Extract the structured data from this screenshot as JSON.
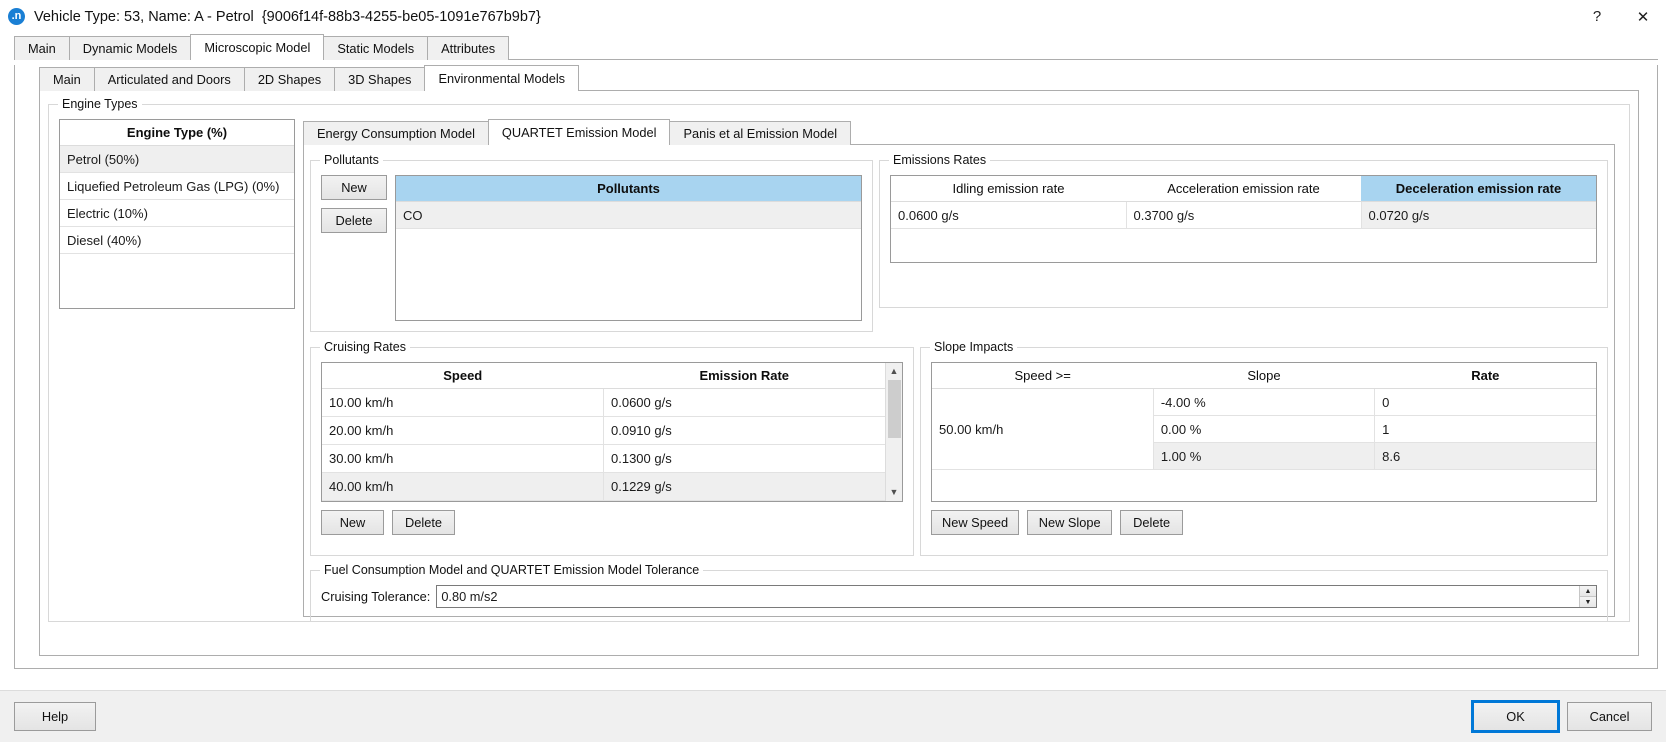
{
  "window": {
    "icon": "aimsun-app-icon",
    "title": "Vehicle Type: 53, Name: A - Petrol",
    "guid": "{9006f14f-88b3-4255-be05-1091e767b9b7}",
    "help_glyph": "?",
    "close_glyph": "✕"
  },
  "tabs_level1": [
    {
      "label": "Main",
      "active": false
    },
    {
      "label": "Dynamic Models",
      "active": false
    },
    {
      "label": "Microscopic Model",
      "active": true
    },
    {
      "label": "Static Models",
      "active": false
    },
    {
      "label": "Attributes",
      "active": false
    }
  ],
  "tabs_level2": [
    {
      "label": "Main",
      "active": false
    },
    {
      "label": "Articulated and Doors",
      "active": false
    },
    {
      "label": "2D Shapes",
      "active": false
    },
    {
      "label": "3D Shapes",
      "active": false
    },
    {
      "label": "Environmental Models",
      "active": true
    }
  ],
  "tabs_level3": [
    {
      "label": "Energy Consumption Model",
      "active": false
    },
    {
      "label": "QUARTET Emission Model",
      "active": true
    },
    {
      "label": "Panis et al Emission Model",
      "active": false
    }
  ],
  "engine_types": {
    "legend": "Engine Types",
    "header": "Engine Type (%)",
    "rows": [
      {
        "label": "Petrol (50%)",
        "selected": true
      },
      {
        "label": "Liquefied Petroleum Gas (LPG) (0%)",
        "selected": false
      },
      {
        "label": "Electric (10%)",
        "selected": false
      },
      {
        "label": "Diesel (40%)",
        "selected": false
      }
    ]
  },
  "pollutants": {
    "legend": "Pollutants",
    "new_label": "New",
    "delete_label": "Delete",
    "header": "Pollutants",
    "rows": [
      {
        "label": "CO",
        "selected": true
      }
    ]
  },
  "emissions_rates": {
    "legend": "Emissions Rates",
    "columns": [
      {
        "label": "Idling emission rate",
        "selected": false
      },
      {
        "label": "Acceleration emission rate",
        "selected": false
      },
      {
        "label": "Deceleration emission rate",
        "selected": true
      }
    ],
    "values": [
      "0.0600 g/s",
      "0.3700 g/s",
      "0.0720 g/s"
    ]
  },
  "cruising_rates": {
    "legend": "Cruising Rates",
    "columns": [
      "Speed",
      "Emission Rate"
    ],
    "rows": [
      {
        "speed": "10.00 km/h",
        "rate": "0.0600 g/s",
        "selected": false
      },
      {
        "speed": "20.00 km/h",
        "rate": "0.0910 g/s",
        "selected": false
      },
      {
        "speed": "30.00 km/h",
        "rate": "0.1300 g/s",
        "selected": false
      },
      {
        "speed": "40.00 km/h",
        "rate": "0.1229 g/s",
        "selected": true
      }
    ],
    "new_label": "New",
    "delete_label": "Delete"
  },
  "slope_impacts": {
    "legend": "Slope Impacts",
    "columns": [
      {
        "label": "Speed >=",
        "bold": false
      },
      {
        "label": "Slope",
        "bold": false
      },
      {
        "label": "Rate",
        "bold": true
      }
    ],
    "speed": "50.00 km/h",
    "rows": [
      {
        "slope": "-4.00 %",
        "rate": "0",
        "selected": false
      },
      {
        "slope": "0.00 %",
        "rate": "1",
        "selected": false
      },
      {
        "slope": "1.00 %",
        "rate": "8.6",
        "selected": true
      }
    ],
    "new_speed_label": "New Speed",
    "new_slope_label": "New Slope",
    "delete_label": "Delete"
  },
  "tolerance": {
    "legend": "Fuel Consumption Model and QUARTET Emission Model Tolerance",
    "label": "Cruising Tolerance:",
    "value": "0.80 m/s2",
    "up_glyph": "▲",
    "down_glyph": "▼"
  },
  "footer": {
    "help_label": "Help",
    "ok_label": "OK",
    "cancel_label": "Cancel"
  },
  "colors": {
    "selection_blue": "#a8d4f0",
    "focus_blue": "#0078d7",
    "row_selected": "#efefef"
  }
}
